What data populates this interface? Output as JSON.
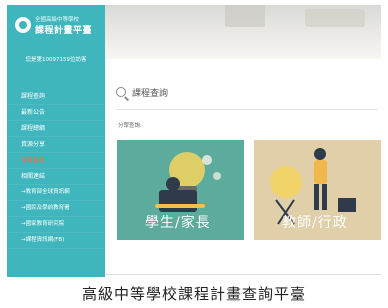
{
  "sidebar": {
    "logo_subtitle": "全國高級中等學校",
    "logo_title": "課程計畫平臺",
    "visit_count": "您是第10097159位訪客",
    "items": [
      {
        "label": "課程查詢",
        "active": false,
        "sub": false
      },
      {
        "label": "最新公告",
        "active": false,
        "sub": false
      },
      {
        "label": "課程總綱",
        "active": false,
        "sub": false
      },
      {
        "label": "資源分享",
        "active": false,
        "sub": false
      },
      {
        "label": "各類書籤",
        "active": true,
        "sub": false
      },
      {
        "label": "相關連結",
        "active": false,
        "sub": false
      },
      {
        "label": "→教育部全球資訊網",
        "active": false,
        "sub": true
      },
      {
        "label": "→國民及學前教育署",
        "active": false,
        "sub": true
      },
      {
        "label": "→國家教育研究院",
        "active": false,
        "sub": true
      },
      {
        "label": "→課程資訊網(FB)",
        "active": false,
        "sub": true
      }
    ]
  },
  "main": {
    "search_title": "課程查詢",
    "category_label": "分眾查詢:",
    "cards": [
      {
        "label": "學生/家長"
      },
      {
        "label": "教師/行政"
      }
    ]
  },
  "caption": "高級中等學校課程計畫查詢平臺",
  "colors": {
    "sidebar": "#3fb6bd",
    "active_item": "#ff6a3d",
    "student_card": "#5cab9c",
    "teacher_card": "#e0cfa8"
  }
}
